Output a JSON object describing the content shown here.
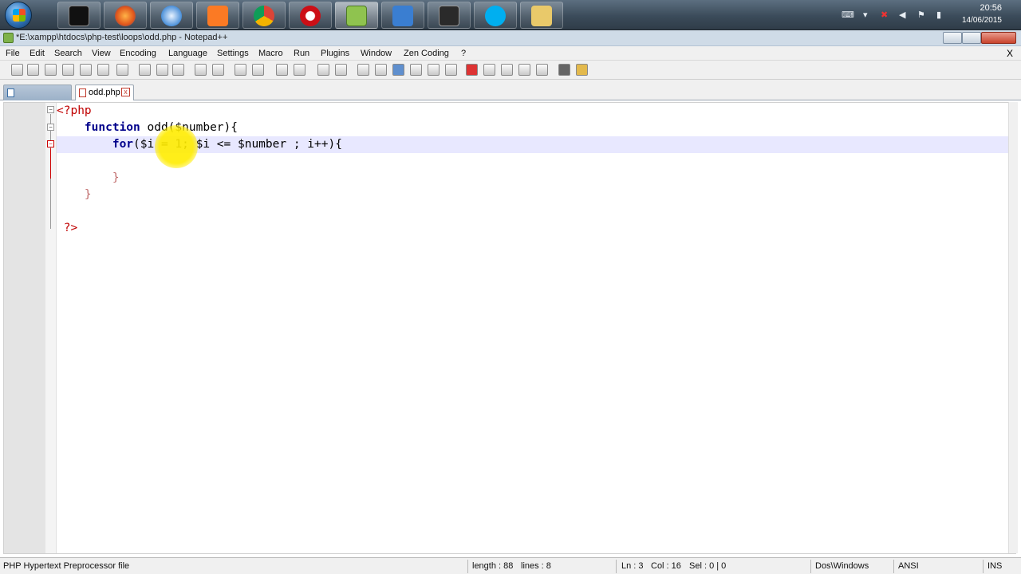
{
  "window": {
    "title": "*E:\\xampp\\htdocs\\php-test\\loops\\odd.php - Notepad++"
  },
  "taskbar": {
    "apps": [
      "windows-start",
      "command-prompt",
      "firefox",
      "safari",
      "xampp",
      "chrome",
      "opera",
      "notepad-plus-plus",
      "snipping-tool",
      "terminal-monitor",
      "skype",
      "explorer"
    ],
    "clock_time": "20:56",
    "clock_date": "14/06/2015"
  },
  "menu": {
    "items": [
      "File",
      "Edit",
      "Search",
      "View",
      "Encoding",
      "Language",
      "Settings",
      "Macro",
      "Run",
      "Plugins",
      "Window",
      "Zen Coding",
      "?"
    ],
    "close": "X"
  },
  "tabs": {
    "active_label": "odd.php",
    "close_symbol": "x"
  },
  "editor": {
    "line1": "<?php",
    "line2_kw": "function",
    "line2_rest": " odd($number){",
    "line3_kw": "for",
    "line3_rest": "($i = 1; $i <= $number ; i++){",
    "line5": "}",
    "line6": "}",
    "line8": "?>"
  },
  "status": {
    "file_type": "PHP Hypertext Preprocessor file",
    "length": "length : 88",
    "lines": "lines : 8",
    "ln": "Ln : 3",
    "col": "Col : 16",
    "sel": "Sel : 0 | 0",
    "eol": "Dos\\Windows",
    "encoding": "ANSI",
    "mode": "INS"
  },
  "colors": {
    "keyword": "#00008b",
    "php_tag": "#c00000",
    "current_line": "#e8e8ff",
    "cursor_highlight": "#ffec00"
  }
}
